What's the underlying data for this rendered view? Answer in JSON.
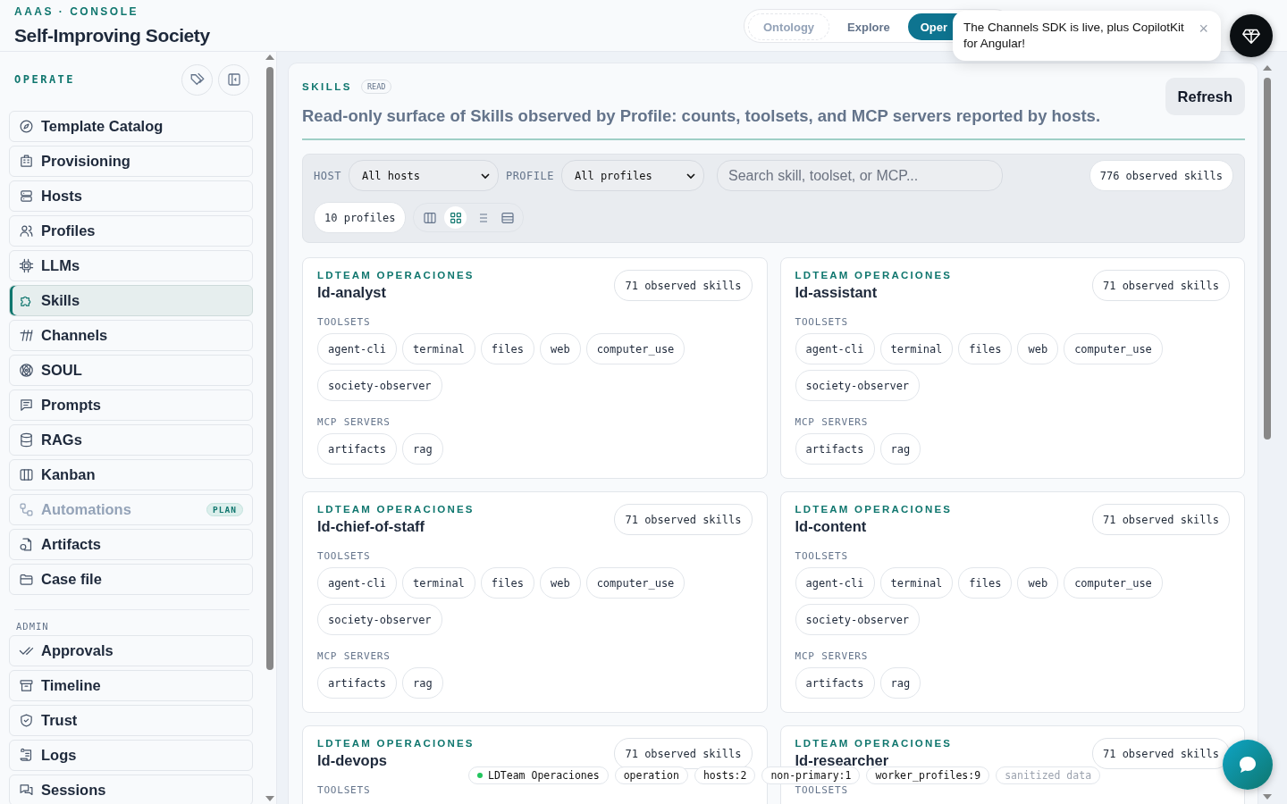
{
  "app": {
    "eyebrow": "AAAS · CONSOLE",
    "title": "Self-Improving Society"
  },
  "top_nav": [
    {
      "label": "Ontology",
      "selected": false,
      "disabled": true
    },
    {
      "label": "Explore",
      "selected": false,
      "disabled": false
    },
    {
      "label": "Oper",
      "selected": true,
      "disabled": false
    }
  ],
  "toast": {
    "message": "The Channels SDK is live, plus CopilotKit for Angular!",
    "close": "×"
  },
  "sidebar": {
    "section": "OPERATE",
    "items": [
      {
        "label": "Template Catalog",
        "selected": false,
        "disabled": false
      },
      {
        "label": "Provisioning",
        "selected": false,
        "disabled": false
      },
      {
        "label": "Hosts",
        "selected": false,
        "disabled": false
      },
      {
        "label": "Profiles",
        "selected": false,
        "disabled": false
      },
      {
        "label": "LLMs",
        "selected": false,
        "disabled": false
      },
      {
        "label": "Skills",
        "selected": true,
        "disabled": false
      },
      {
        "label": "Channels",
        "selected": false,
        "disabled": false
      },
      {
        "label": "SOUL",
        "selected": false,
        "disabled": false
      },
      {
        "label": "Prompts",
        "selected": false,
        "disabled": false
      },
      {
        "label": "RAGs",
        "selected": false,
        "disabled": false
      },
      {
        "label": "Kanban",
        "selected": false,
        "disabled": false
      },
      {
        "label": "Automations",
        "selected": false,
        "disabled": true,
        "badge": "PLAN"
      },
      {
        "label": "Artifacts",
        "selected": false,
        "disabled": false
      },
      {
        "label": "Case file",
        "selected": false,
        "disabled": false
      }
    ],
    "admin_section": "ADMIN",
    "admin_items": [
      {
        "label": "Approvals",
        "selected": false,
        "disabled": false
      },
      {
        "label": "Timeline",
        "selected": false,
        "disabled": false
      },
      {
        "label": "Trust",
        "selected": false,
        "disabled": false
      },
      {
        "label": "Logs",
        "selected": false,
        "disabled": false
      },
      {
        "label": "Sessions",
        "selected": false,
        "disabled": false
      }
    ]
  },
  "page": {
    "eyebrow": "SKILLS",
    "badge": "READ",
    "subtitle": "Read-only surface of Skills observed by Profile: counts, toolsets, and MCP servers reported by hosts.",
    "refresh": "Refresh"
  },
  "filters": {
    "host_label": "HOST",
    "host_value": "All hosts",
    "profile_label": "PROFILE",
    "profile_value": "All profiles",
    "search_placeholder": "Search skill, toolset, or MCP...",
    "total": "776 observed skills",
    "profiles": "10 profiles",
    "views": [
      {
        "kind": "columns",
        "selected": false
      },
      {
        "kind": "grid",
        "selected": true
      },
      {
        "kind": "list",
        "selected": false
      },
      {
        "kind": "rows",
        "selected": false
      }
    ]
  },
  "cards": [
    {
      "org": "LDTEAM OPERACIONES",
      "name": "ld-analyst",
      "count": "71 observed skills",
      "toolsets_label": "TOOLSETS",
      "toolsets": [
        "agent-cli",
        "terminal",
        "files",
        "web",
        "computer_use",
        "society-observer"
      ],
      "mcp_label": "MCP SERVERS",
      "mcp": [
        "artifacts",
        "rag"
      ]
    },
    {
      "org": "LDTEAM OPERACIONES",
      "name": "ld-assistant",
      "count": "71 observed skills",
      "toolsets_label": "TOOLSETS",
      "toolsets": [
        "agent-cli",
        "terminal",
        "files",
        "web",
        "computer_use",
        "society-observer"
      ],
      "mcp_label": "MCP SERVERS",
      "mcp": [
        "artifacts",
        "rag"
      ]
    },
    {
      "org": "LDTEAM OPERACIONES",
      "name": "ld-chief-of-staff",
      "count": "71 observed skills",
      "toolsets_label": "TOOLSETS",
      "toolsets": [
        "agent-cli",
        "terminal",
        "files",
        "web",
        "computer_use",
        "society-observer"
      ],
      "mcp_label": "MCP SERVERS",
      "mcp": [
        "artifacts",
        "rag"
      ]
    },
    {
      "org": "LDTEAM OPERACIONES",
      "name": "ld-content",
      "count": "71 observed skills",
      "toolsets_label": "TOOLSETS",
      "toolsets": [
        "agent-cli",
        "terminal",
        "files",
        "web",
        "computer_use",
        "society-observer"
      ],
      "mcp_label": "MCP SERVERS",
      "mcp": [
        "artifacts",
        "rag"
      ]
    },
    {
      "org": "LDTEAM OPERACIONES",
      "name": "ld-devops",
      "count": "71 observed skills",
      "toolsets_label": "TOOLSETS"
    },
    {
      "org": "LDTEAM OPERACIONES",
      "name": "ld-researcher",
      "count": "71 observed skills",
      "toolsets_label": "TOOLSETS"
    }
  ],
  "context_bar": [
    {
      "label": "LDTeam Operaciones",
      "kind": "status",
      "color": "#22c55e"
    },
    {
      "label": "operation",
      "kind": "plain"
    },
    {
      "label": "hosts:2",
      "kind": "plain"
    },
    {
      "label": "non-primary:1",
      "kind": "plain"
    },
    {
      "label": "worker_profiles:9",
      "kind": "plain"
    },
    {
      "label": "sanitized data",
      "kind": "muted"
    }
  ]
}
